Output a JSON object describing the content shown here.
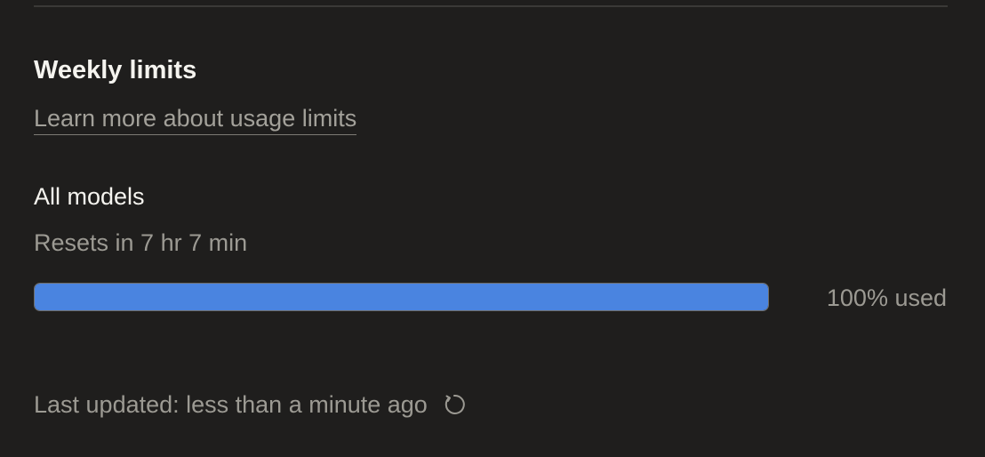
{
  "section": {
    "title": "Weekly limits",
    "learn_more_link": "Learn more about usage limits"
  },
  "usage": {
    "model_label": "All models",
    "reset_text": "Resets in 7 hr 7 min",
    "progress_fraction": 1.0,
    "progress_color": "#4a84e0",
    "usage_label": "100% used"
  },
  "footer": {
    "last_updated": "Last updated: less than a minute ago",
    "refresh_icon": "refresh-icon"
  }
}
